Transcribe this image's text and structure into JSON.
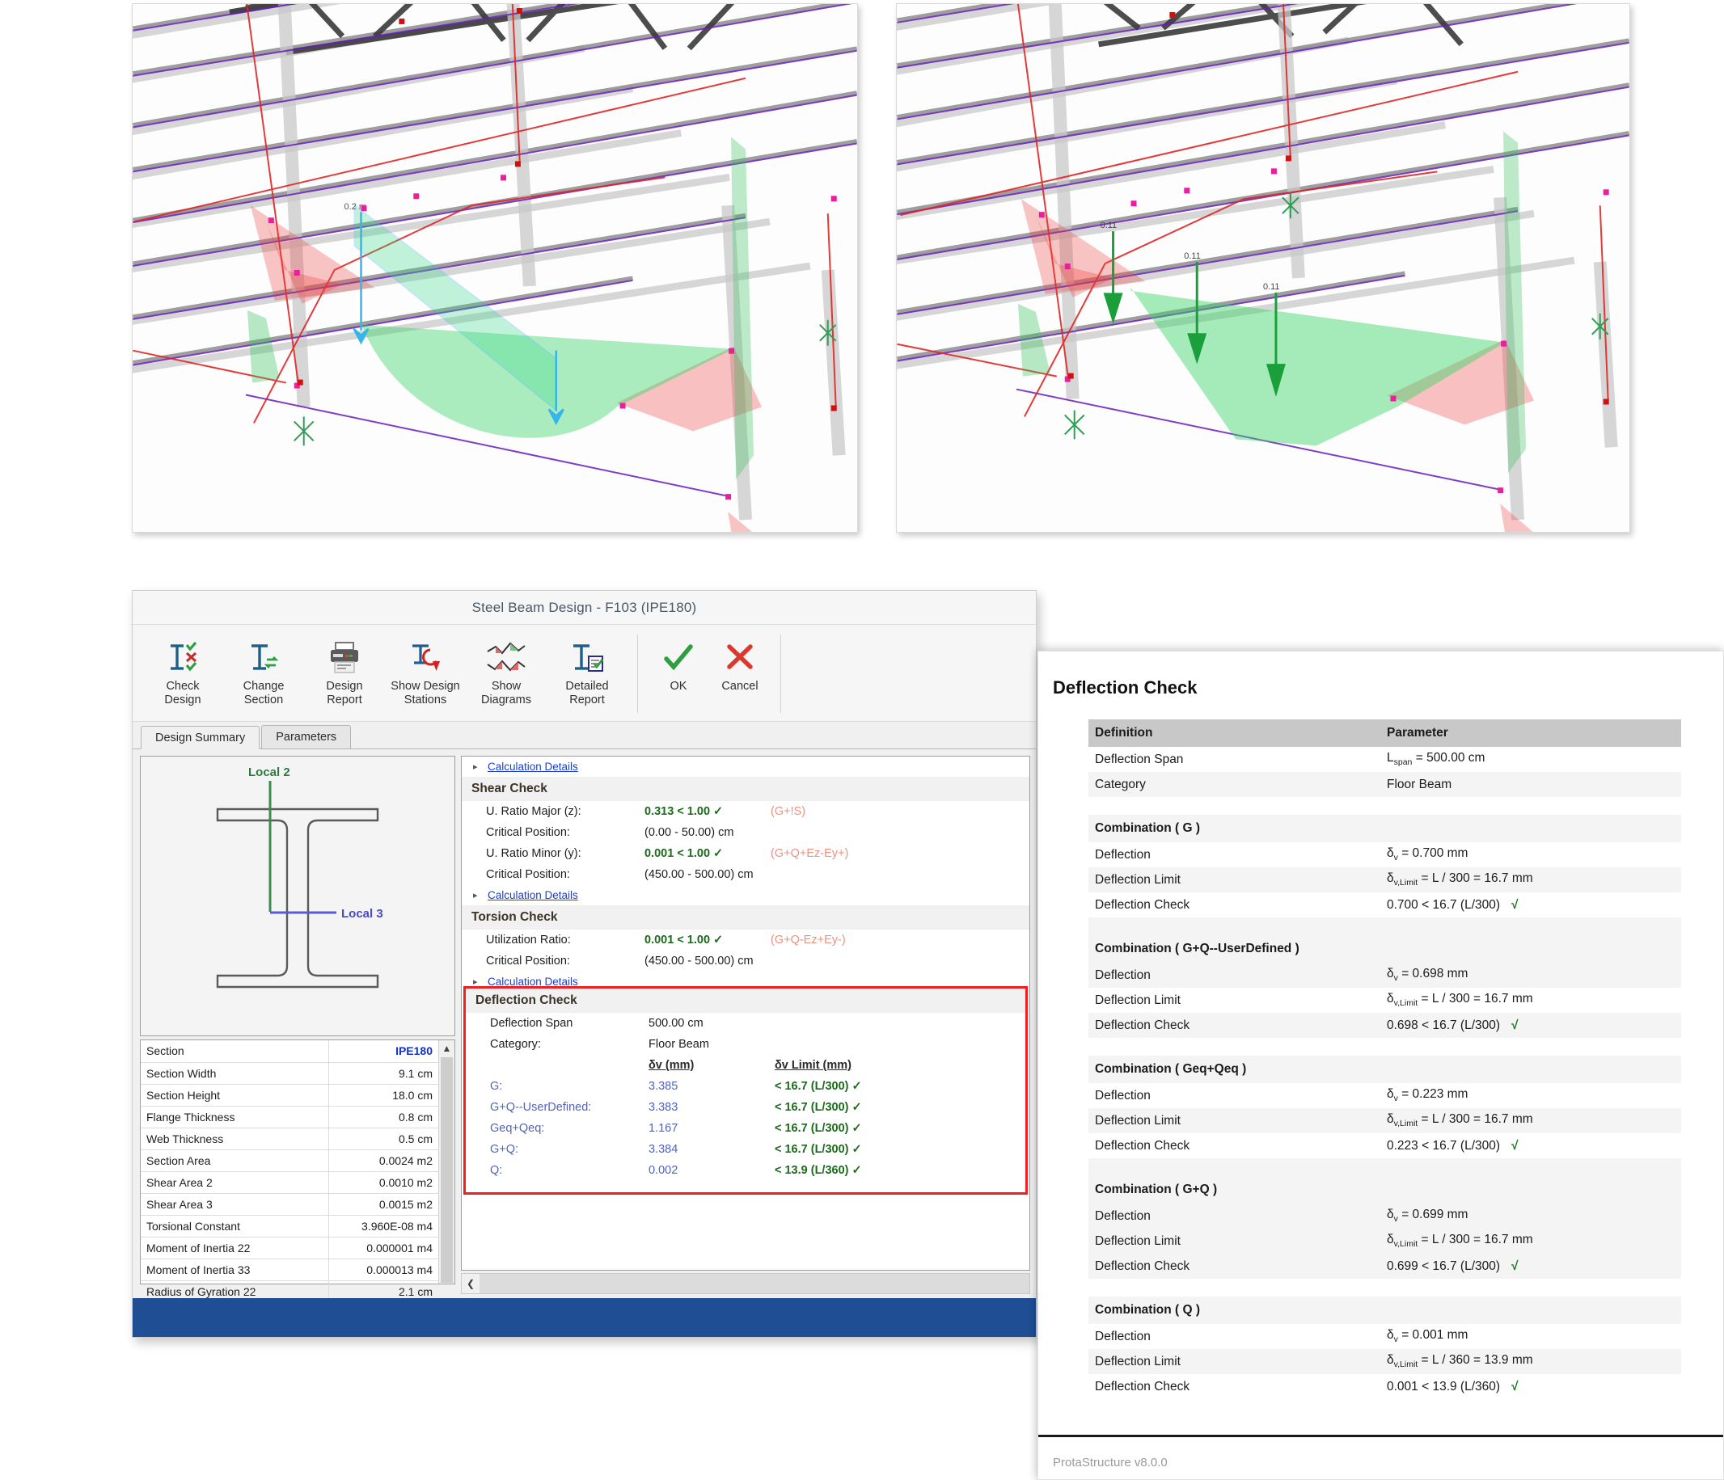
{
  "viewports": [
    {
      "name": "left-viewport",
      "annotations": [
        "0.2 m"
      ],
      "caption": "3D frame model with deflection diagram and uniform line load"
    },
    {
      "name": "right-viewport",
      "annotations": [
        "0.11",
        "0.11",
        "0.11"
      ],
      "caption": "3D frame model with point load arrows"
    }
  ],
  "dialog": {
    "title": "Steel Beam Design - F103 (IPE180)",
    "ribbon": [
      {
        "icon": "check-design-icon",
        "label": "Check\nDesign"
      },
      {
        "icon": "change-section-icon",
        "label": "Change\nSection"
      },
      {
        "icon": "printer-icon",
        "label": "Design\nReport"
      },
      {
        "icon": "design-stations-icon",
        "label": "Show Design\nStations"
      },
      {
        "icon": "diagrams-icon",
        "label": "Show Diagrams"
      },
      {
        "icon": "detailed-report-icon",
        "label": "Detailed\nReport"
      }
    ],
    "confirm": [
      {
        "icon": "check-mark-icon",
        "label": "OK"
      },
      {
        "icon": "cross-mark-icon",
        "label": "Cancel"
      }
    ],
    "tabs": [
      {
        "label": "Design Summary",
        "active": true
      },
      {
        "label": "Parameters",
        "active": false
      }
    ],
    "section_preview": {
      "axis_2_label": "Local 2",
      "axis_3_label": "Local 3",
      "axis_2_color": "#3c8c4e",
      "axis_3_color": "#5b5bd6"
    },
    "properties": [
      {
        "key": "Section",
        "value": "IPE180",
        "accent": true
      },
      {
        "key": "Section Width",
        "value": "9.1 cm"
      },
      {
        "key": "Section Height",
        "value": "18.0 cm"
      },
      {
        "key": "Flange Thickness",
        "value": "0.8 cm"
      },
      {
        "key": "Web Thickness",
        "value": "0.5 cm"
      },
      {
        "key": "Section Area",
        "value": "0.0024 m2"
      },
      {
        "key": "Shear Area 2",
        "value": "0.0010 m2"
      },
      {
        "key": "Shear Area 3",
        "value": "0.0015 m2"
      },
      {
        "key": "Torsional Constant",
        "value": "3.960E-08 m4"
      },
      {
        "key": "Moment of Inertia 22",
        "value": "0.000001 m4"
      },
      {
        "key": "Moment of Inertia 33",
        "value": "0.000013 m4"
      },
      {
        "key": "Radius of Gyration 22",
        "value": "2.1 cm"
      }
    ],
    "results": {
      "top_link": "Calculation Details",
      "shear": {
        "heading": "Shear Check",
        "rows": [
          {
            "label": "U. Ratio Major (z):",
            "value": "0.313  < 1.00 ✓",
            "combo": "(G+!S)",
            "bold": true
          },
          {
            "label": "Critical Position:",
            "value": "(0.00 - 50.00) cm",
            "combo": "",
            "bold": false
          },
          {
            "label": "U. Ratio Minor (y):",
            "value": "0.001  < 1.00 ✓",
            "combo": "(G+Q+Ez-Ey+)",
            "bold": true
          },
          {
            "label": "Critical Position:",
            "value": "(450.00 - 500.00) cm",
            "combo": "",
            "bold": false
          }
        ],
        "link": "Calculation Details"
      },
      "torsion": {
        "heading": "Torsion Check",
        "rows": [
          {
            "label": "Utilization Ratio:",
            "value": "0.001  < 1.00 ✓",
            "combo": "(G+Q-Ez+Ey-)",
            "bold": true
          },
          {
            "label": "Critical Position:",
            "value": "(450.00 - 500.00) cm",
            "combo": "",
            "bold": false
          }
        ],
        "link": "Calculation Details"
      },
      "deflection": {
        "heading": "Deflection Check",
        "span_label": "Deflection Span",
        "span_value": "500.00 cm",
        "category_label": "Category:",
        "category_value": "Floor Beam",
        "col_defl": "δv (mm)",
        "col_limit": "δv Limit (mm)",
        "rows": [
          {
            "combo": "G:",
            "defl": "3.385",
            "limit": "< 16.7 (L/300) ✓"
          },
          {
            "combo": "G+Q--UserDefined:",
            "defl": "3.383",
            "limit": "< 16.7 (L/300) ✓"
          },
          {
            "combo": "Geq+Qeq:",
            "defl": "1.167",
            "limit": "< 16.7 (L/300) ✓"
          },
          {
            "combo": "G+Q:",
            "defl": "3.384",
            "limit": "< 16.7 (L/300) ✓"
          },
          {
            "combo": "Q:",
            "defl": "0.002",
            "limit": "< 13.9 (L/360) ✓"
          }
        ]
      }
    }
  },
  "report": {
    "title": "Deflection Check",
    "headers": {
      "definition": "Definition",
      "parameter": "Parameter"
    },
    "definition_rows": [
      {
        "label": "Deflection Span",
        "value": "L_span = 500.00 cm",
        "value_pre": "L",
        "value_sub": "span",
        "value_post": " = 500.00 cm"
      },
      {
        "label": "Category",
        "value": "Floor Beam",
        "value_pre": "Floor Beam",
        "value_sub": "",
        "value_post": ""
      }
    ],
    "combinations": [
      {
        "title": "Combination ( G )",
        "deflection_label": "Deflection",
        "deflection_pre": "δ",
        "deflection_sub": "v",
        "deflection_post": " = 0.700 mm",
        "limit_label": "Deflection Limit",
        "limit_pre": "δ",
        "limit_sub": "v,Limit",
        "limit_post": " = L / 300 = 16.7 mm",
        "check_label": "Deflection Check",
        "check_value": "0.700 < 16.7 (L/300)",
        "check_tick": "√"
      },
      {
        "title": "Combination ( G+Q--UserDefined )",
        "deflection_label": "Deflection",
        "deflection_pre": "δ",
        "deflection_sub": "v",
        "deflection_post": " = 0.698 mm",
        "limit_label": "Deflection Limit",
        "limit_pre": "δ",
        "limit_sub": "v,Limit",
        "limit_post": " = L / 300 = 16.7 mm",
        "check_label": "Deflection Check",
        "check_value": "0.698 < 16.7 (L/300)",
        "check_tick": "√"
      },
      {
        "title": "Combination ( Geq+Qeq )",
        "deflection_label": "Deflection",
        "deflection_pre": "δ",
        "deflection_sub": "v",
        "deflection_post": " = 0.223 mm",
        "limit_label": "Deflection Limit",
        "limit_pre": "δ",
        "limit_sub": "v,Limit",
        "limit_post": " = L / 300 = 16.7 mm",
        "check_label": "Deflection Check",
        "check_value": "0.223 < 16.7 (L/300)",
        "check_tick": "√"
      },
      {
        "title": "Combination ( G+Q )",
        "deflection_label": "Deflection",
        "deflection_pre": "δ",
        "deflection_sub": "v",
        "deflection_post": " = 0.699 mm",
        "limit_label": "Deflection Limit",
        "limit_pre": "δ",
        "limit_sub": "v,Limit",
        "limit_post": " = L / 300 = 16.7 mm",
        "check_label": "Deflection Check",
        "check_value": "0.699 < 16.7 (L/300)",
        "check_tick": "√"
      },
      {
        "title": "Combination ( Q )",
        "deflection_label": "Deflection",
        "deflection_pre": "δ",
        "deflection_sub": "v",
        "deflection_post": " = 0.001 mm",
        "limit_label": "Deflection Limit",
        "limit_pre": "δ",
        "limit_sub": "v,Limit",
        "limit_post": " = L / 360 = 13.9 mm",
        "check_label": "Deflection Check",
        "check_value": "0.001 < 13.9 (L/360)",
        "check_tick": "√"
      }
    ],
    "footer": "ProtaStructure v8.0.0"
  },
  "colors": {
    "accent_blue": "#1330c8",
    "highlight_red": "#f02020",
    "pass_green": "#14761a",
    "combo_salmon": "#ef8f7d",
    "footer_blue": "#1f4e94",
    "report_header_gray": "#c8c8c8"
  }
}
